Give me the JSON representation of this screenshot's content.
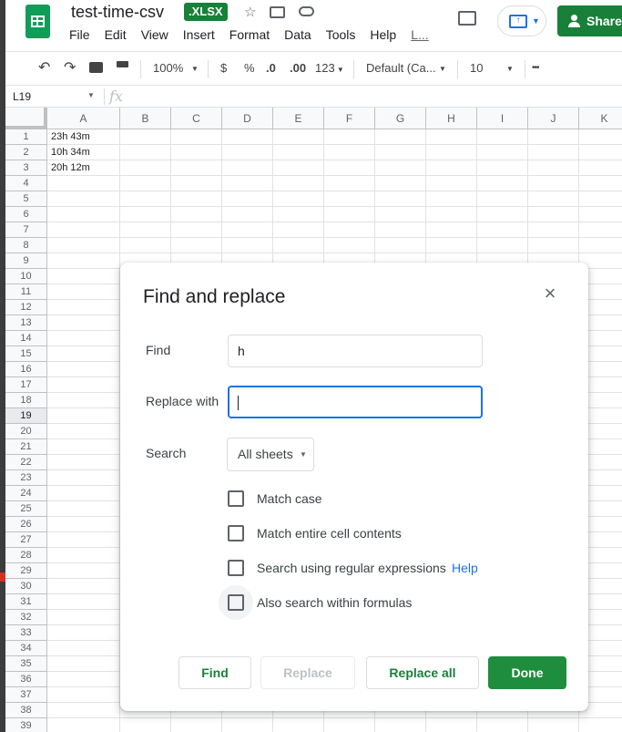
{
  "header": {
    "doc_title": "test-time-csv",
    "file_badge": "XLSX",
    "share_label": "Share",
    "menu": [
      "File",
      "Edit",
      "View",
      "Insert",
      "Format",
      "Data",
      "Tools",
      "Help"
    ],
    "last_edit": "L..."
  },
  "toolbar": {
    "zoom": "100%",
    "currency": "$",
    "percent": "%",
    "decimal_decrease": ".0",
    "decimal_increase": ".00",
    "number_format": "123",
    "font": "Default (Ca...",
    "font_size": "10",
    "more": "•••"
  },
  "formula_bar": {
    "cell_ref": "L19",
    "fx": "fx"
  },
  "grid": {
    "columns": [
      "A",
      "B",
      "C",
      "D",
      "E",
      "F",
      "G",
      "H",
      "I",
      "J",
      "K"
    ],
    "rows": [
      "1",
      "2",
      "3",
      "4",
      "5",
      "6",
      "7",
      "8",
      "9",
      "10",
      "11",
      "12",
      "13",
      "14",
      "15",
      "16",
      "17",
      "18",
      "19",
      "20",
      "21",
      "22",
      "23",
      "24",
      "25",
      "26",
      "27",
      "28",
      "29",
      "30",
      "31",
      "32",
      "33",
      "34",
      "35",
      "36",
      "37",
      "38",
      "39"
    ],
    "selected_row": "19",
    "cells": {
      "A1": "23h 43m",
      "A2": "10h 34m",
      "A3": "20h 12m"
    }
  },
  "dialog": {
    "title": "Find and replace",
    "find_label": "Find",
    "find_value": "h",
    "replace_label": "Replace with",
    "replace_value": ":",
    "search_label": "Search",
    "search_value": "All sheets",
    "options": [
      {
        "label": "Match case",
        "checked": false
      },
      {
        "label": "Match entire cell contents",
        "checked": false
      },
      {
        "label": "Search using regular expressions",
        "checked": false
      },
      {
        "label": "Also search within formulas",
        "checked": false
      }
    ],
    "help_link": "Help",
    "buttons": {
      "find": "Find",
      "replace": "Replace",
      "replace_all": "Replace all",
      "done": "Done"
    }
  }
}
